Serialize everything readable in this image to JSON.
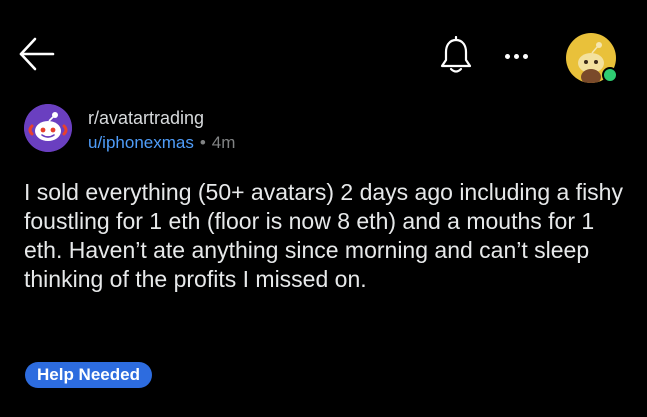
{
  "header": {
    "back_icon": "arrow-left-icon",
    "bell_icon": "bell-icon",
    "more_icon": "more-horizontal-icon",
    "user_avatar": "snoo-avatar"
  },
  "post": {
    "subreddit": "r/avatartrading",
    "author": "u/iphonexmas",
    "separator": "•",
    "age": "4m",
    "body": "I sold everything (50+ avatars) 2 days ago including a fishy foustling for 1 eth (floor is now 8 eth) and a mouths for 1 eth. Haven’t ate anything since morning and can’t sleep thinking of the profits I missed on.",
    "flair": "Help Needed"
  },
  "colors": {
    "background": "#000000",
    "username": "#4f9df9",
    "flair": "#2d6cdf",
    "meta": "#818384",
    "online": "#2ecc71",
    "subreddit_icon": "#6a3fc0",
    "user_avatar": "#e9c13a"
  }
}
